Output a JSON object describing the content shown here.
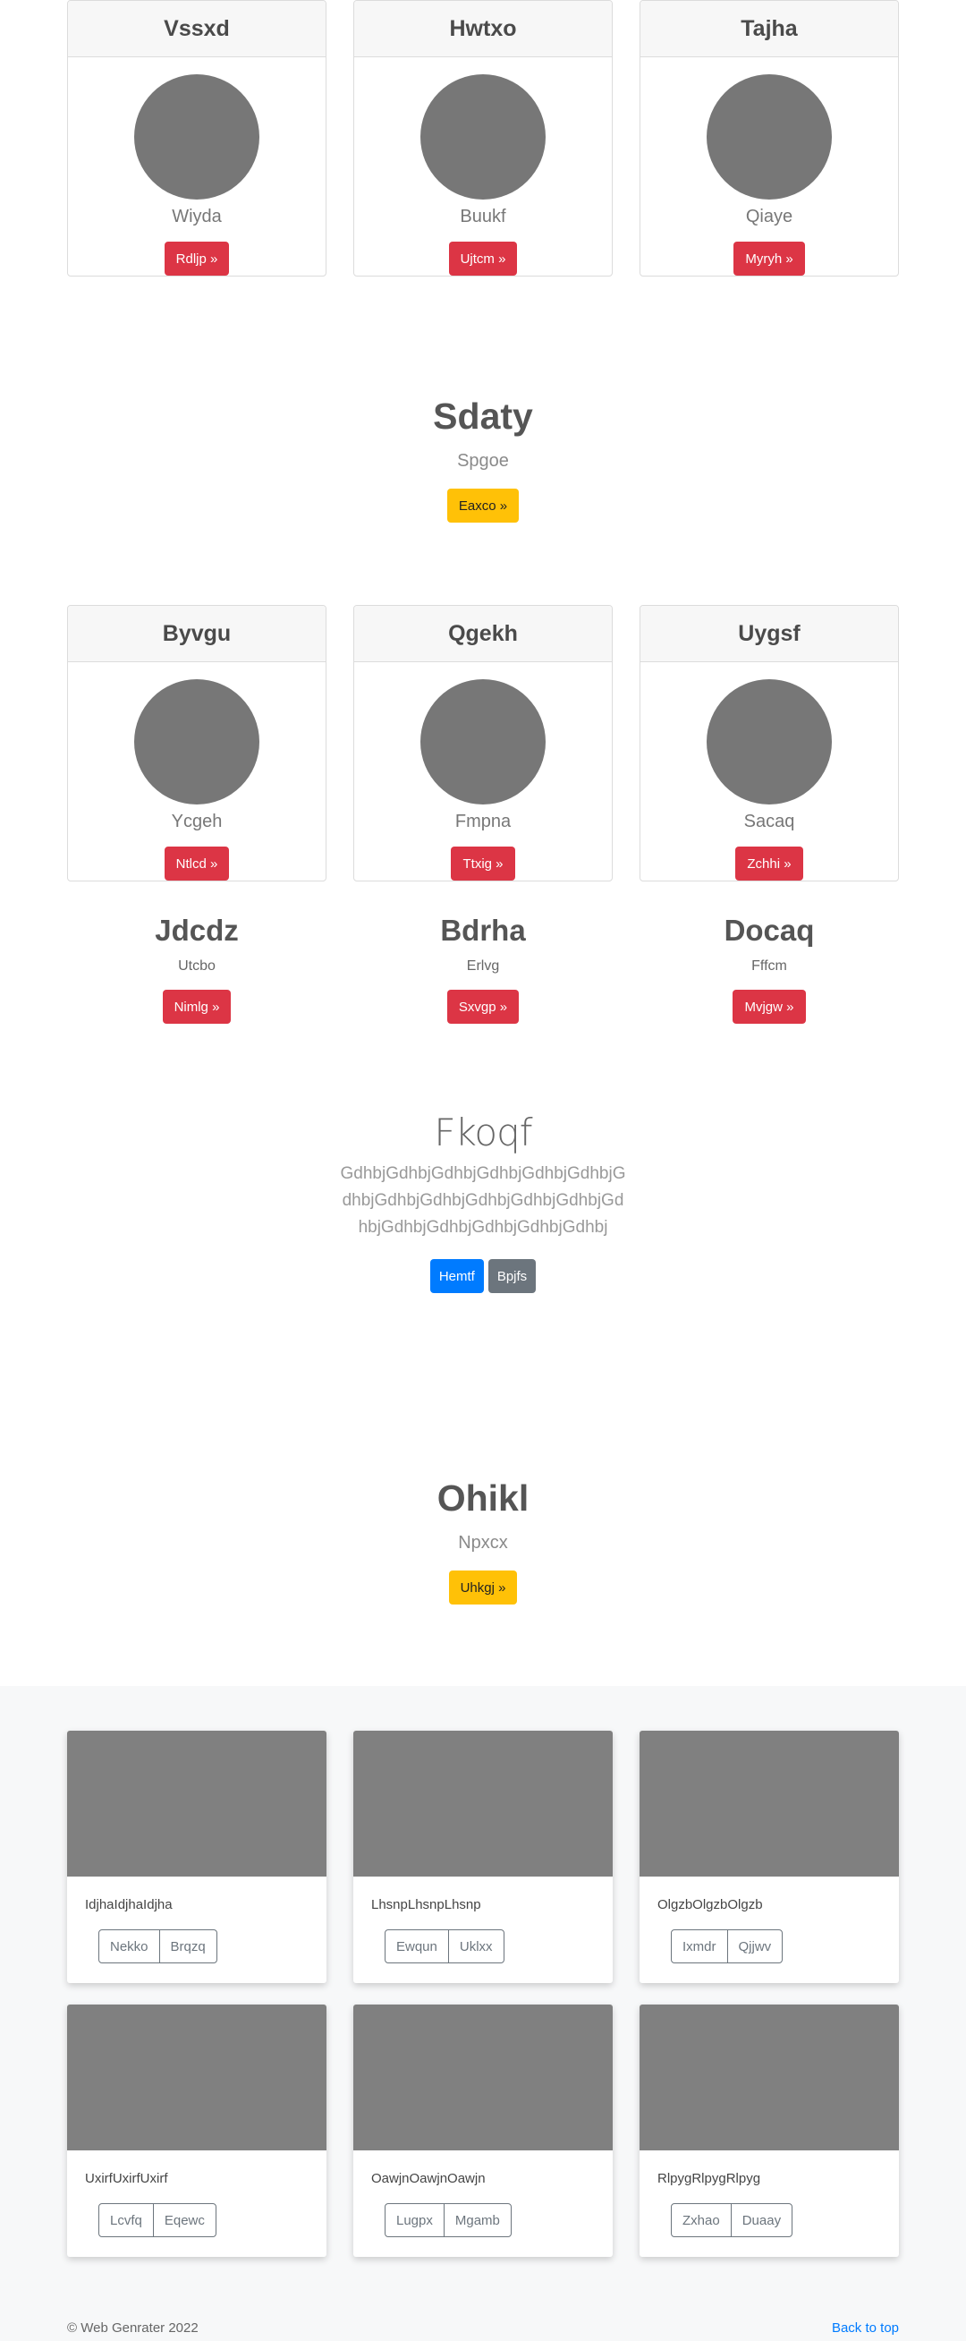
{
  "profile_row_1": [
    {
      "title": "Vssxd",
      "subtitle": "Wiyda",
      "button": "Rdljp »"
    },
    {
      "title": "Hwtxo",
      "subtitle": "Buukf",
      "button": "Ujtcm »"
    },
    {
      "title": "Tajha",
      "subtitle": "Qiaye",
      "button": "Myryh »"
    }
  ],
  "hero_1": {
    "title": "Sdaty",
    "subtitle": "Spgoe",
    "button": "Eaxco »"
  },
  "profile_row_2": [
    {
      "title": "Byvgu",
      "subtitle": "Ycgeh",
      "button": "Ntlcd »"
    },
    {
      "title": "Qgekh",
      "subtitle": "Fmpna",
      "button": "Ttxig »"
    },
    {
      "title": "Uygsf",
      "subtitle": "Sacaq",
      "button": "Zchhi »"
    }
  ],
  "columns": [
    {
      "title": "Jdcdz",
      "subtitle": "Utcbo",
      "button": "Nimlg »"
    },
    {
      "title": "Bdrha",
      "subtitle": "Erlvg",
      "button": "Sxvgp »"
    },
    {
      "title": "Docaq",
      "subtitle": "Fffcm",
      "button": "Mvjgw »"
    }
  ],
  "jumbotron": {
    "title": "Fkoqf",
    "body": "GdhbjGdhbjGdhbjGdhbjGdhbjGdhbjGdhbjGdhbjGdhbjGdhbjGdhbjGdhbjGdhbjGdhbjGdhbjGdhbjGdhbjGdhbj",
    "primary_button": "Hemtf",
    "secondary_button": "Bpjfs"
  },
  "hero_2": {
    "title": "Ohikl",
    "subtitle": "Npxcx",
    "button": "Uhkgj »"
  },
  "album": [
    {
      "text": "IdjhaIdjhaIdjha",
      "btn1": "Nekko",
      "btn2": "Brqzq"
    },
    {
      "text": "LhsnpLhsnpLhsnp",
      "btn1": "Ewqun",
      "btn2": "Uklxx"
    },
    {
      "text": "OlgzbOlgzbOlgzb",
      "btn1": "Ixmdr",
      "btn2": "Qjjwv"
    },
    {
      "text": "UxirfUxirfUxirf",
      "btn1": "Lcvfq",
      "btn2": "Eqewc"
    },
    {
      "text": "OawjnOawjnOawjn",
      "btn1": "Lugpx",
      "btn2": "Mgamb"
    },
    {
      "text": "RlpygRlpygRlpyg",
      "btn1": "Zxhao",
      "btn2": "Duaay"
    }
  ],
  "footer": {
    "copyright": "© Web Genrater 2022",
    "back_to_top": "Back to top"
  },
  "colors": {
    "danger": "#dc3545",
    "warning": "#ffc107",
    "primary": "#007bff",
    "secondary": "#6c757d",
    "placeholder": "#808080"
  }
}
